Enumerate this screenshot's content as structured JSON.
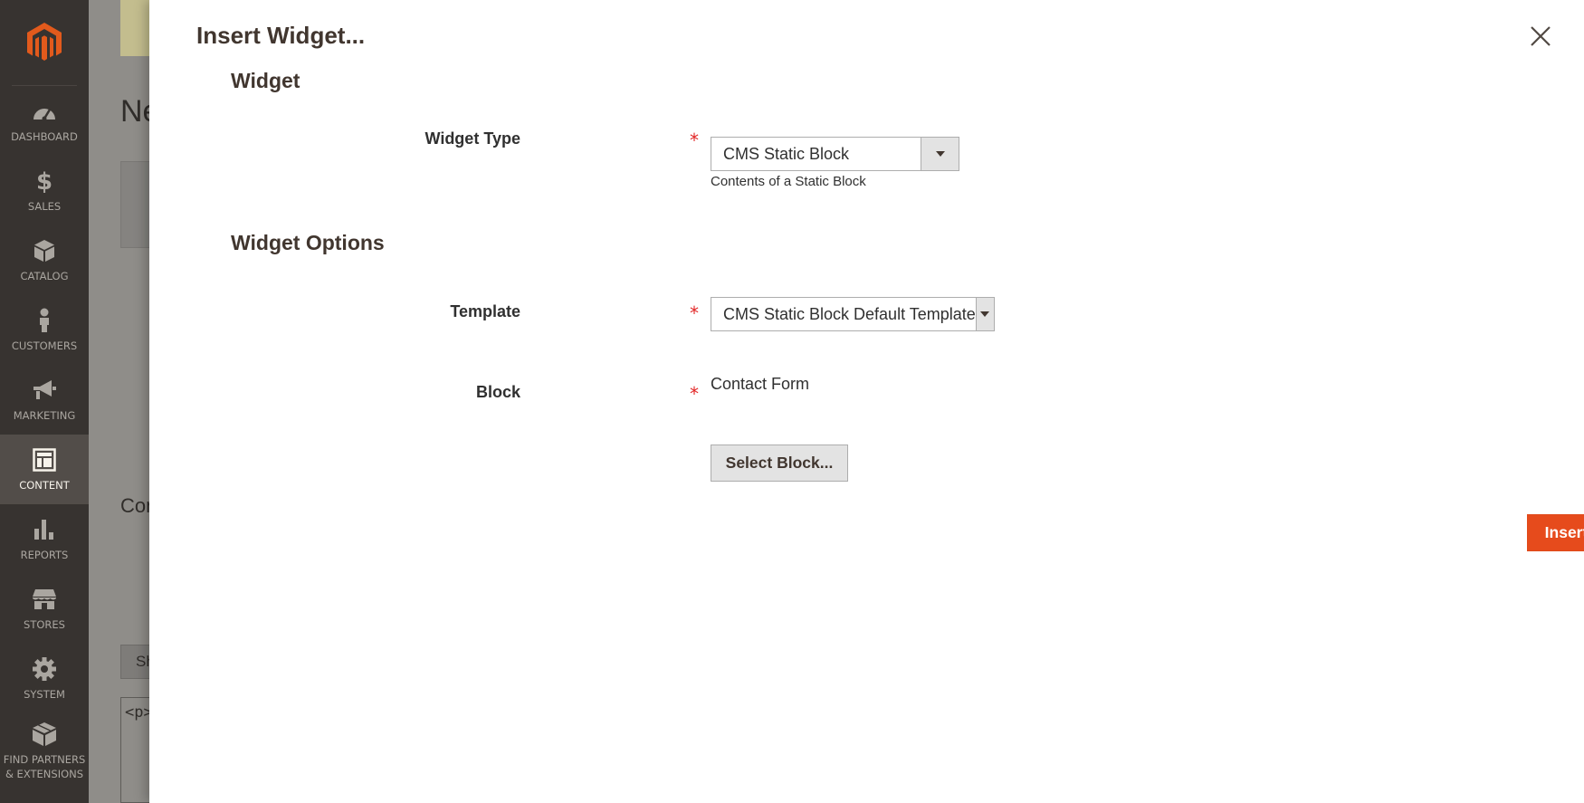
{
  "admin_menu": {
    "items": [
      {
        "label": "DASHBOARD",
        "icon": "dashboard-icon",
        "active": false
      },
      {
        "label": "SALES",
        "icon": "dollar-icon",
        "active": false
      },
      {
        "label": "CATALOG",
        "icon": "box-icon",
        "active": false
      },
      {
        "label": "CUSTOMERS",
        "icon": "person-icon",
        "active": false
      },
      {
        "label": "MARKETING",
        "icon": "megaphone-icon",
        "active": false
      },
      {
        "label": "CONTENT",
        "icon": "layout-icon",
        "active": true
      },
      {
        "label": "REPORTS",
        "icon": "bar-chart-icon",
        "active": false
      },
      {
        "label": "STORES",
        "icon": "storefront-icon",
        "active": false
      },
      {
        "label": "SYSTEM",
        "icon": "gear-icon",
        "active": false
      },
      {
        "label": "FIND PARTNERS & EXTENSIONS",
        "icon": "cubes-icon",
        "active": false
      }
    ]
  },
  "background_page": {
    "title_fragment": "Ne",
    "section_fragment": "Con",
    "button_fragment": "Sh",
    "textarea_fragment": "<p>"
  },
  "modal": {
    "title": "Insert Widget...",
    "widget_section": {
      "title": "Widget",
      "widget_type_label": "Widget Type",
      "widget_type_value": "CMS Static Block",
      "widget_type_note": "Contents of a Static Block"
    },
    "options_section": {
      "title": "Widget Options",
      "template_label": "Template",
      "template_value": "CMS Static Block Default Template",
      "block_label": "Block",
      "block_value": "Contact Form",
      "select_block_button": "Select Block..."
    },
    "insert_button": "Insert Widget",
    "required_marker": "*"
  },
  "colors": {
    "menu_bg": "#373330",
    "menu_active_bg": "#524d49",
    "logo_orange": "#e25a1c",
    "primary_button": "#e64b1c",
    "required_star": "#e22626"
  }
}
